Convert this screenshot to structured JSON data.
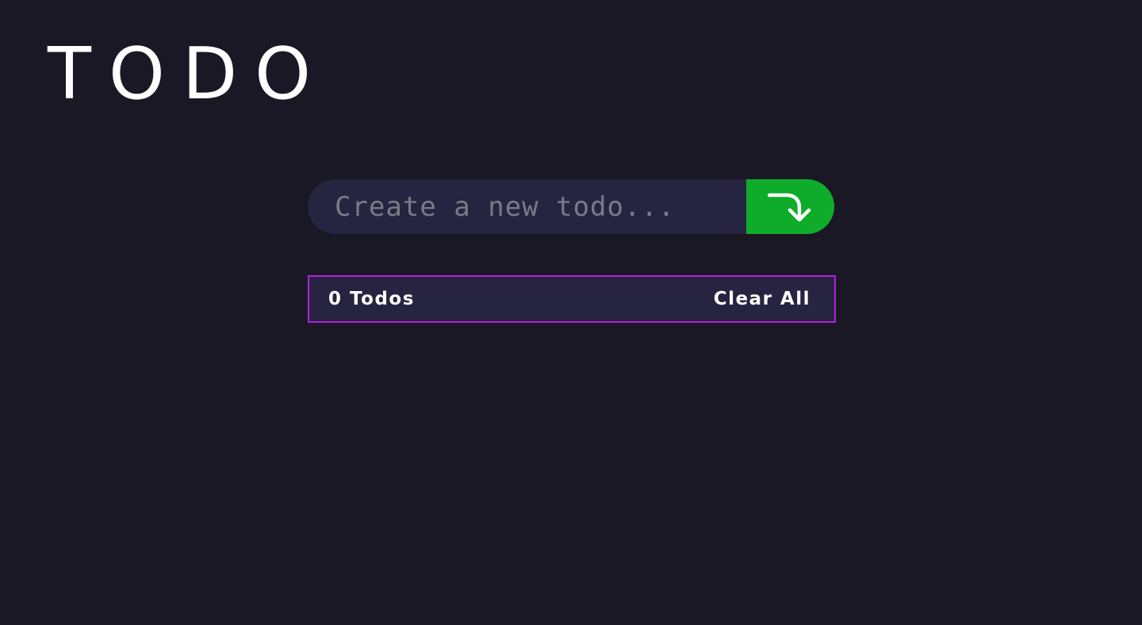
{
  "app": {
    "title": "TODO"
  },
  "form": {
    "input_placeholder": "Create a new todo...",
    "input_value": "",
    "submit_icon": "arrow-turn-down-right-icon",
    "submit_color": "#0eac2a"
  },
  "status": {
    "count_label": "0 Todos",
    "clear_label": "Clear All",
    "border_color": "#b51ee3"
  },
  "colors": {
    "background": "#1a1824",
    "panel": "#262440",
    "placeholder": "#7c7a86"
  }
}
